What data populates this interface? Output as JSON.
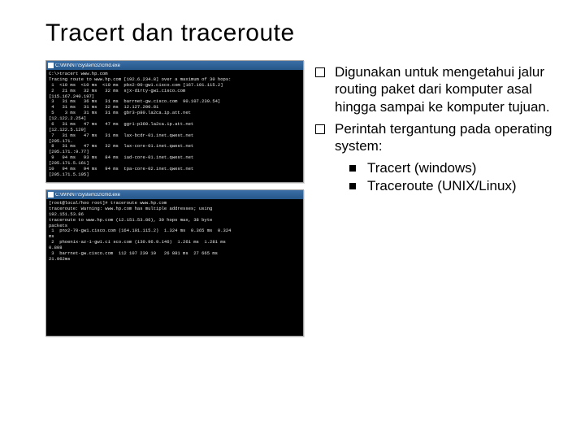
{
  "title": "Tracert dan traceroute",
  "terminals": {
    "a": {
      "title": "C:\\WINNT\\System32\\cmd.exe",
      "body": "C:\\>tracert www.hp.com\nTracing route to www.hp.com [192.6.234.8] over a maximum of 30 hops:\n 1  <10 ms  <10 ms  <10 ms  pbx2-00-gw1.cisco.com [167.101.115.2]\n 2   21 ms   32 ms   32 ms  sjx-dirty-gw1.cisco.com\n[115.167.240.197]\n 3   31 ms   36 ms   31 ms  barrnet-gw.cisco.com  90.107.239.54]\n 4   31 ms   31 ms   32 ms  12.127.200.81\n 5    3 ms   31 ms   31 ms  gbr3-p80.la2ca.ip.att.net\n[12.122.2.254]\n 6   31 ms   47 ms   47 ms  ggr1-p360.la2ca.ip.att.net\n[12.122.5.129]\n 7   31 ms   47 ms   31 ms  lax-bcdr-01.inet.qwest.net\n[205.171.\n 8   31 ms   47 ms   32 ms  lax-core-01.inet.qwest.net\n[205.171.:9.77]\n 9   94 ms   93 ms   84 ms  iad-core-01.inet.qwest.net\n[205.171.5.161]\n10   94 ms   94 ms   94 ms  tpa-core-02.inet.qwest.net\n[205.171.5.105]"
    },
    "b": {
      "title": "C:\\WINNT\\System32\\cmd.exe",
      "body": "[root@local/hoo root]# traceroute www.hp.com\ntraceroute: Warning: www.hp.com has multiple addresses; using\n192.151.53.86\ntraceroute to www.hp.com (12.151.53.86), 30 hops max, 38 byte\npackets\n 1  pnx2-70-gw1.cisco.com (164.101.115.2)  1.324 ms  0.365 ms  0.324\nms\n 2  phoenix-az-1-gw1.ci sco.com (130.96.9.146)  1.261 ms  1.281 ms\n0.808\n 3  barrnet-gw.cisco.com  112 107 239 10   26 881 ms  27 665 ms\n21.962ms\n\n\n\n\n\n\n\n\n\n\n"
    }
  },
  "bullets": [
    {
      "text": "Digunakan untuk mengetahui jalur routing paket dari komputer asal hingga sampai ke komputer tujuan."
    },
    {
      "text": "Perintah tergantung pada operating system:"
    }
  ],
  "subbullets": [
    {
      "text": "Tracert (windows)"
    },
    {
      "text": "Traceroute (UNIX/Linux)"
    }
  ]
}
